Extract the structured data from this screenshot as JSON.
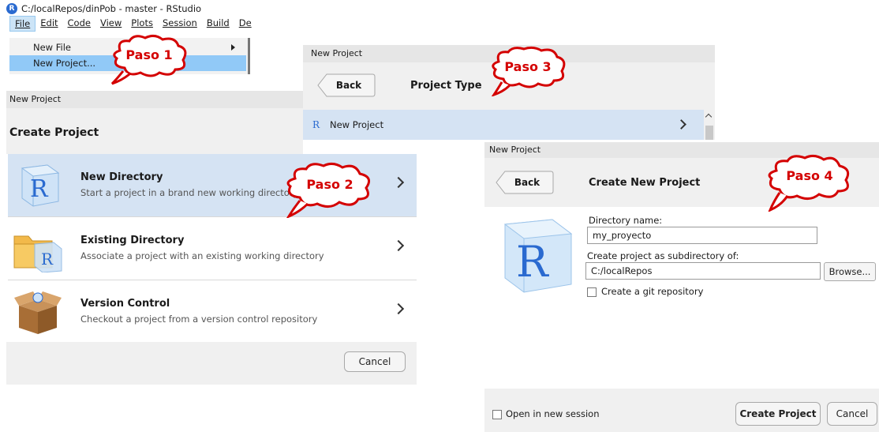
{
  "panel1": {
    "window_title": "C:/localRepos/dinPob - master - RStudio",
    "menubar": [
      "File",
      "Edit",
      "Code",
      "View",
      "Plots",
      "Session",
      "Build",
      "De"
    ],
    "dropdown": [
      "New File",
      "New Project..."
    ]
  },
  "panel2": {
    "dialog_title": "New Project",
    "heading": "Create Project",
    "options": [
      {
        "title": "New Directory",
        "subtitle": "Start a project in a brand new working directory"
      },
      {
        "title": "Existing Directory",
        "subtitle": "Associate a project with an existing working directory"
      },
      {
        "title": "Version Control",
        "subtitle": "Checkout a project from a version control repository"
      }
    ],
    "cancel": "Cancel"
  },
  "panel3": {
    "dialog_title": "New Project",
    "back": "Back",
    "heading": "Project Type",
    "row_label": "New Project"
  },
  "panel4": {
    "dialog_title": "New Project",
    "back": "Back",
    "heading": "Create New Project",
    "dir_name_label": "Directory name:",
    "dir_name_value": "my_proyecto",
    "subdir_label": "Create project as subdirectory of:",
    "subdir_value": "C:/localRepos",
    "browse": "Browse...",
    "git_label": "Create a git repository",
    "open_session_label": "Open in new session",
    "create": "Create Project",
    "cancel": "Cancel"
  },
  "callouts": [
    "Paso 1",
    "Paso 2",
    "Paso 3",
    "Paso 4"
  ],
  "colors": {
    "callout": "#d40000",
    "selection": "#d5e3f3",
    "menu_highlight": "#91c9f7"
  }
}
